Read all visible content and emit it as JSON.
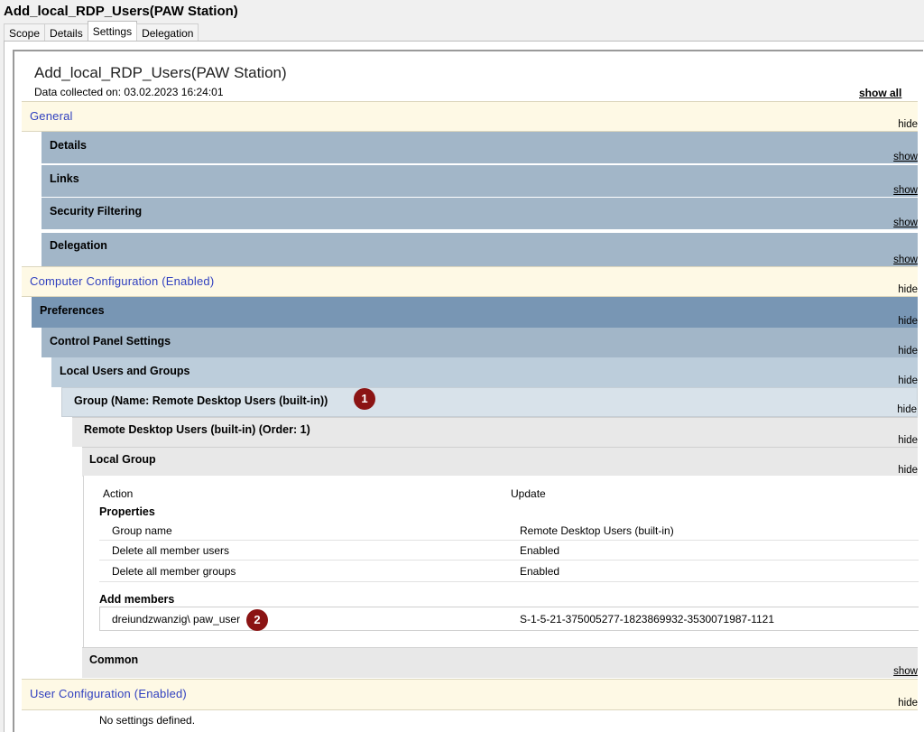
{
  "window": {
    "title": "Add_local_RDP_Users(PAW Station)"
  },
  "tabs": [
    "Scope",
    "Details",
    "Settings",
    "Delegation"
  ],
  "active_tab": "Settings",
  "report": {
    "title": "Add_local_RDP_Users(PAW Station)",
    "collected": "Data collected on: 03.02.2023 16:24:01",
    "show_all": "show all"
  },
  "sections": {
    "general": {
      "label": "General",
      "toggle": "hide"
    },
    "details": {
      "label": "Details",
      "toggle": "show"
    },
    "links": {
      "label": "Links",
      "toggle": "show"
    },
    "security_filtering": {
      "label": "Security Filtering",
      "toggle": "show"
    },
    "delegation": {
      "label": "Delegation",
      "toggle": "show"
    },
    "computer_config": {
      "label": "Computer Configuration (Enabled)",
      "toggle": "hide"
    },
    "preferences": {
      "label": "Preferences",
      "toggle": "hide"
    },
    "control_panel": {
      "label": "Control Panel Settings",
      "toggle": "hide"
    },
    "local_users_groups": {
      "label": "Local Users and Groups",
      "toggle": "hide"
    },
    "group": {
      "label": "Group (Name: Remote Desktop Users (built-in))",
      "toggle": "hide",
      "badge": "1"
    },
    "rdu_order": {
      "label": "Remote Desktop Users (built-in) (Order: 1)",
      "toggle": "hide"
    },
    "local_group": {
      "label": "Local Group",
      "toggle": "hide"
    },
    "common": {
      "label": "Common",
      "toggle": "show"
    },
    "user_config": {
      "label": "User Configuration (Enabled)",
      "toggle": "hide"
    }
  },
  "local_group_table": {
    "action_label": "Action",
    "action_value": "Update",
    "properties_heading": "Properties",
    "properties": [
      {
        "name": "Group name",
        "value": "Remote Desktop Users (built-in)"
      },
      {
        "name": "Delete all member users",
        "value": "Enabled"
      },
      {
        "name": "Delete all member groups",
        "value": "Enabled"
      }
    ],
    "add_members_heading": "Add members",
    "member": {
      "name": "dreiundzwanzig\\ paw_user",
      "sid": "S-1-5-21-375005277-1823869932-3530071987-1121",
      "badge": "2"
    }
  },
  "user_config_note": "No settings defined."
}
